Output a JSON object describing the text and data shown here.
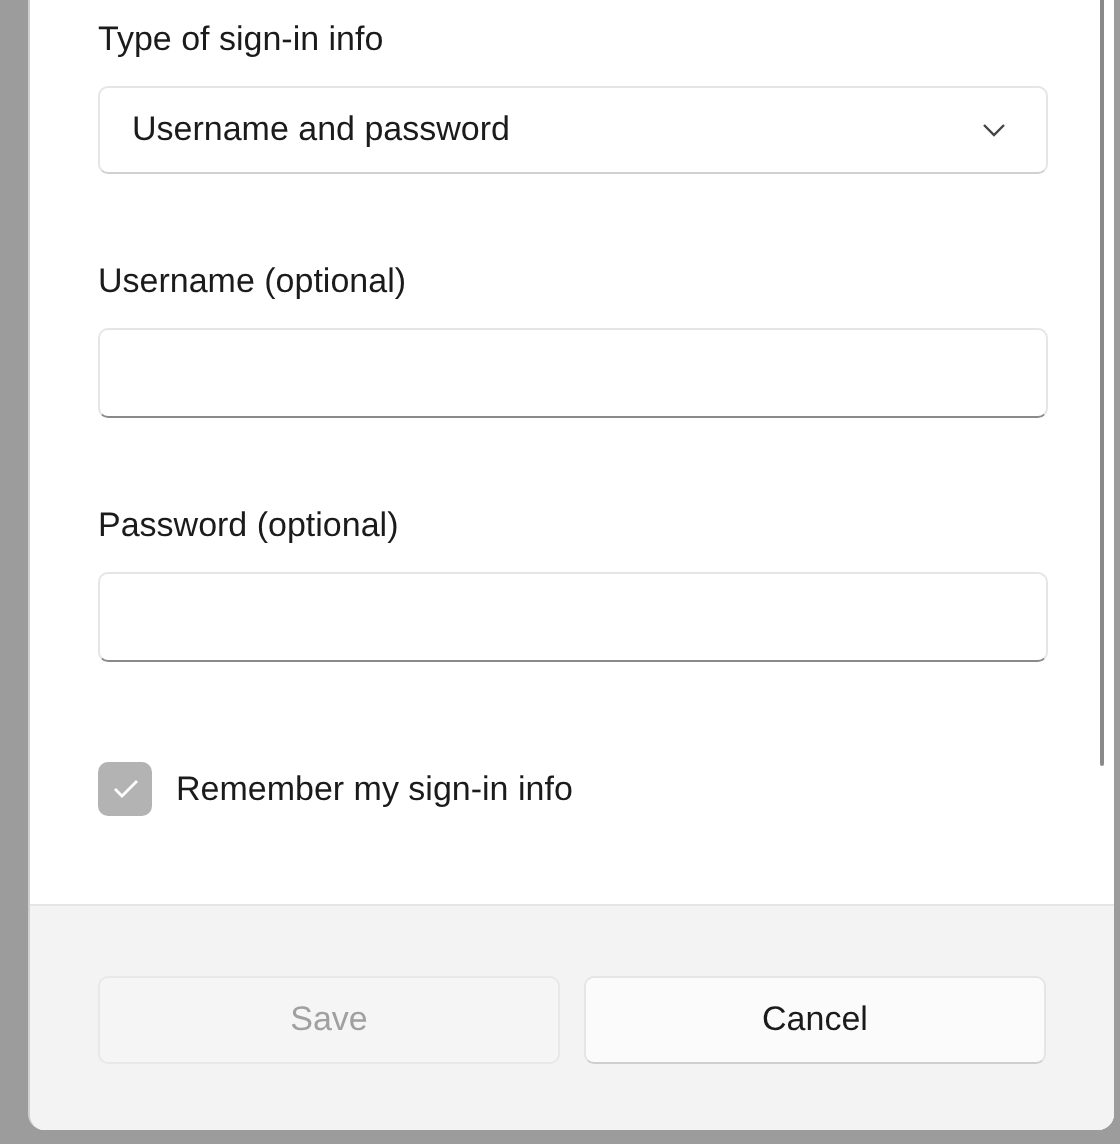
{
  "sign_in_type": {
    "label": "Type of sign-in info",
    "value": "Username and password"
  },
  "fields": [
    {
      "label": "Username (optional)"
    },
    {
      "label": "Password (optional)"
    }
  ],
  "remember": {
    "label": "Remember my sign-in info",
    "checked": true,
    "disabled": true
  },
  "buttons": [
    {
      "label": "Save",
      "disabled": true
    },
    {
      "label": "Cancel",
      "disabled": false
    }
  ]
}
